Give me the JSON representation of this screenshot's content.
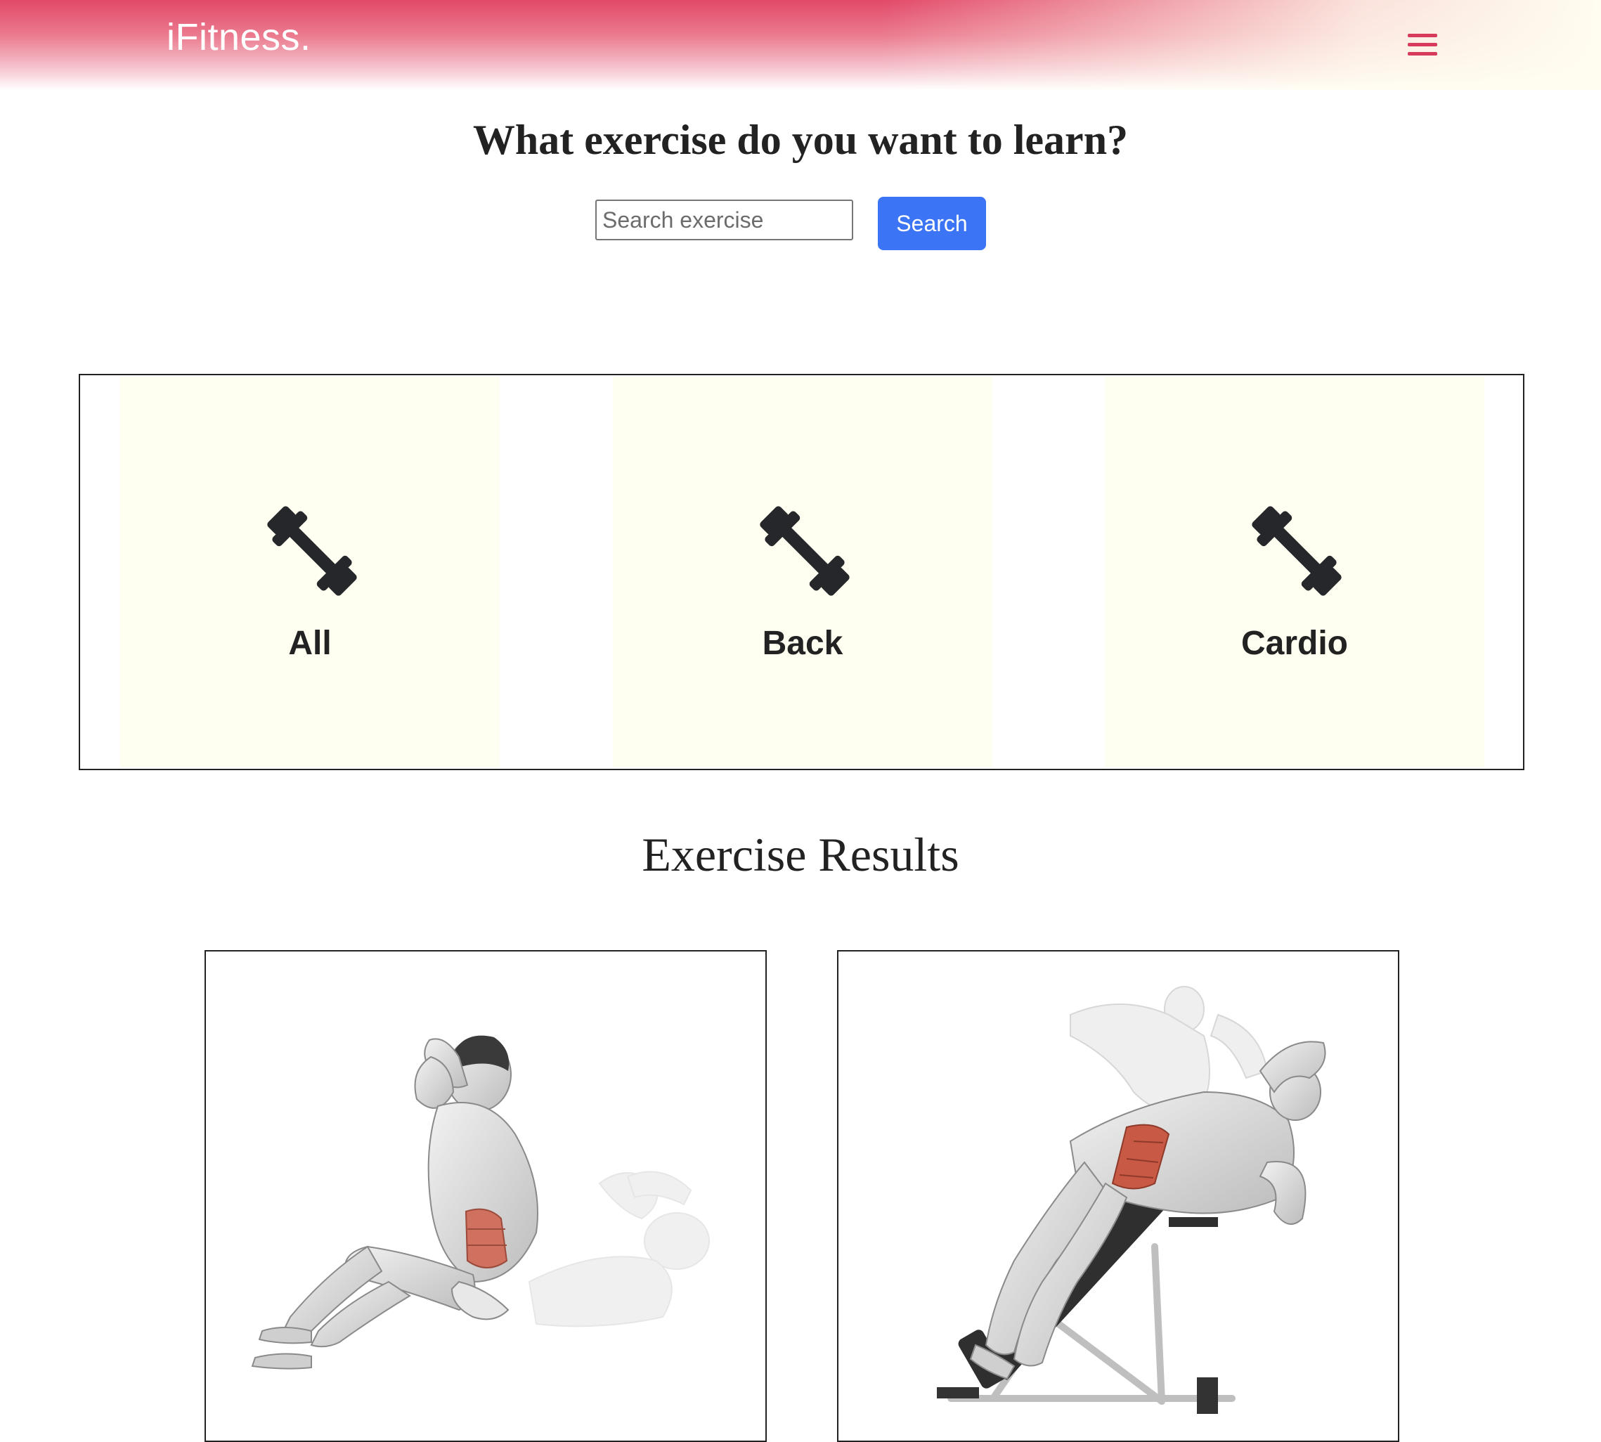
{
  "navbar": {
    "brand": "iFitness.",
    "menu_icon": "hamburger-menu-icon",
    "colors": {
      "gradient_start": "#e24868",
      "menu_icon": "#d83a5b"
    }
  },
  "hero": {
    "title": "What exercise do you want to learn?",
    "search": {
      "placeholder": "Search exercise",
      "value": ""
    },
    "search_button_label": "Search",
    "colors": {
      "search_button": "#3b74f5"
    }
  },
  "categories": {
    "items": [
      {
        "label": "All",
        "icon": "dumbbell-icon"
      },
      {
        "label": "Back",
        "icon": "dumbbell-icon"
      },
      {
        "label": "Cardio",
        "icon": "dumbbell-icon"
      }
    ],
    "colors": {
      "card_background": "#fefff0"
    }
  },
  "results": {
    "title": "Exercise Results",
    "cards": [
      {
        "image": "crunch-exercise-illustration"
      },
      {
        "image": "hyperextension-bench-side-crunch-illustration"
      }
    ]
  }
}
